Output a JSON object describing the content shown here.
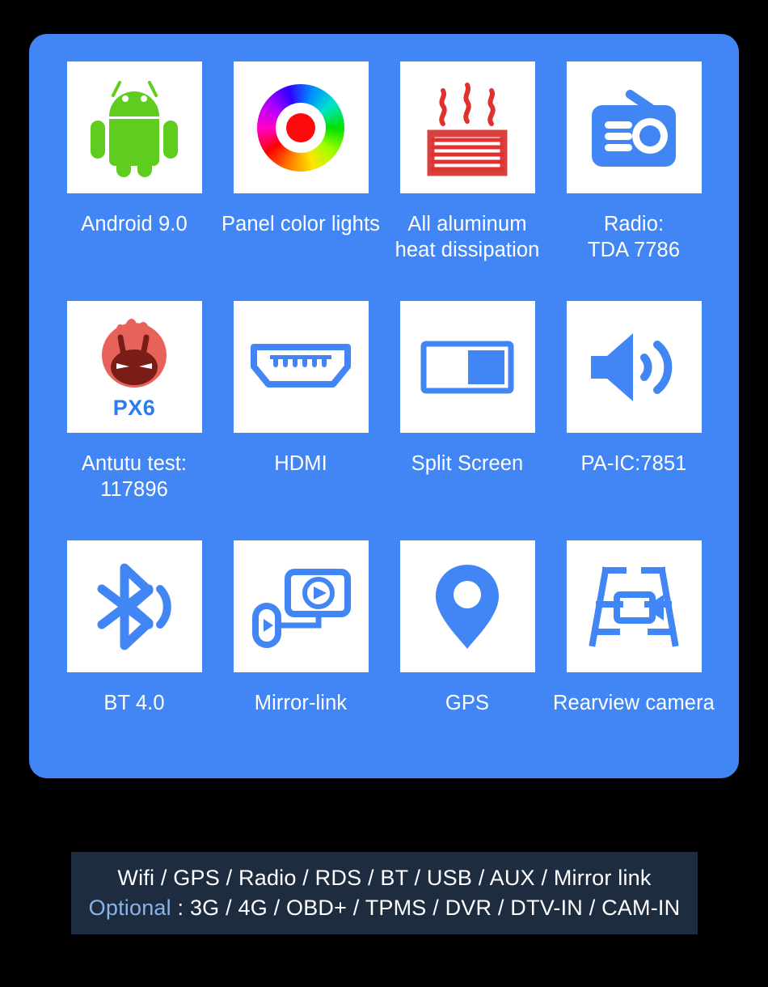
{
  "panel": {
    "background_color": "#4285f4",
    "rows": [
      [
        {
          "icon": "android-robot-icon",
          "label": "Android 9.0"
        },
        {
          "icon": "color-wheel-icon",
          "label": "Panel color lights"
        },
        {
          "icon": "heatsink-icon",
          "label": "All aluminum\nheat dissipation"
        },
        {
          "icon": "radio-icon",
          "label": "Radio:\nTDA 7786"
        }
      ],
      [
        {
          "icon": "antutu-benchmark-icon",
          "badge": "PX6",
          "label": "Antutu test:\n117896"
        },
        {
          "icon": "hdmi-port-icon",
          "label": "HDMI"
        },
        {
          "icon": "split-screen-icon",
          "label": "Split Screen"
        },
        {
          "icon": "speaker-volume-icon",
          "label": "PA-IC:7851"
        }
      ],
      [
        {
          "icon": "bluetooth-icon",
          "label": "BT 4.0"
        },
        {
          "icon": "mirror-link-icon",
          "label": "Mirror-link"
        },
        {
          "icon": "gps-pin-icon",
          "label": "GPS"
        },
        {
          "icon": "rearview-camera-icon",
          "label": "Rearview camera"
        }
      ]
    ]
  },
  "spec_banner": {
    "background_color": "#1e2c3f",
    "line1": "Wifi / GPS / Radio / RDS / BT / USB / AUX / Mirror link",
    "optional_label": "Optional",
    "optional_separator": " : ",
    "optional_value": "3G / 4G / OBD+ / TPMS / DVR / DTV-IN / CAM-IN",
    "optional_color": "#8ab4e8"
  },
  "colors": {
    "panel_blue": "#4285f4",
    "icon_blue": "#4285f4",
    "android_green": "#5fcc20",
    "heat_red": "#e0312f",
    "antutu_red": "#e8625c",
    "antutu_dark": "#7a1c18",
    "px6_blue": "#2d7bf0",
    "background": "#000000"
  }
}
